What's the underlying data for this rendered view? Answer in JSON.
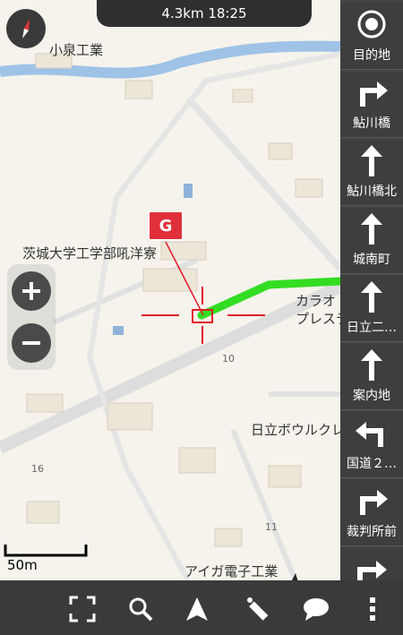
{
  "header": {
    "status": "4.3km 18:25"
  },
  "map": {
    "labels": {
      "koizumi": "小泉工業",
      "ibaraki": "茨城大学工学部吼洋寮",
      "karaoke": "カラオ",
      "plesteage": "プレステー",
      "hitachi_bowl": "日立ボウルクレー",
      "aiga": "アイガ電子工業",
      "block10": "10",
      "block11": "11",
      "block16": "16"
    },
    "goal_marker": "G",
    "scale": "50m"
  },
  "sidebar": {
    "items": [
      {
        "label": "目的地",
        "icon": "target-icon"
      },
      {
        "label": "鮎川橋",
        "icon": "turn-right-icon"
      },
      {
        "label": "鮎川橋北",
        "icon": "straight-icon"
      },
      {
        "label": "城南町",
        "icon": "straight-icon"
      },
      {
        "label": "日立二…",
        "icon": "straight-icon"
      },
      {
        "label": "案内地",
        "icon": "straight-icon"
      },
      {
        "label": "国道２…",
        "icon": "turn-left-icon"
      },
      {
        "label": "裁判所前",
        "icon": "turn-right-icon"
      }
    ]
  },
  "toolbar": {
    "items": [
      "fullscreen-icon",
      "search-icon",
      "navigate-icon",
      "tool-icon",
      "chat-icon",
      "more-icon"
    ]
  },
  "colors": {
    "route": "#33dd22",
    "crosshair": "#e21a2a",
    "goal": "#e0303a",
    "road": "#dcdcdc",
    "river": "#9ec3e6"
  }
}
